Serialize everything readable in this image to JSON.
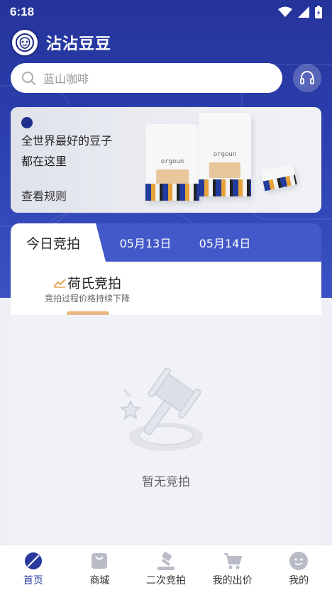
{
  "status_bar": {
    "time": "6:18"
  },
  "app": {
    "title": "沾沾豆豆"
  },
  "search": {
    "placeholder": "蓝山咖啡"
  },
  "banner": {
    "line1": "全世界最好的豆子",
    "line2": "都在这里",
    "link": "查看规则",
    "product_brand": "orgoun"
  },
  "date_tabs": [
    {
      "label": "今日竞拍",
      "active": true
    },
    {
      "label": "05月13日",
      "active": false
    },
    {
      "label": "05月14日",
      "active": false
    }
  ],
  "section": {
    "title": "荷氏竞拍",
    "subtitle": "竞拍过程价格持续下降"
  },
  "empty_state": {
    "text": "暂无竞拍"
  },
  "bottom_nav": [
    {
      "label": "首页",
      "icon": "coffee-bean-icon",
      "active": true
    },
    {
      "label": "商城",
      "icon": "shopping-bag-icon",
      "active": false
    },
    {
      "label": "二次竞拍",
      "icon": "auction-hammer-icon",
      "active": false
    },
    {
      "label": "我的出价",
      "icon": "cart-icon",
      "active": false
    },
    {
      "label": "我的",
      "icon": "profile-avatar-icon",
      "active": false
    }
  ],
  "colors": {
    "brand_blue": "#2c3fae",
    "tab_blue": "#4359c9",
    "active_nav": "#2a3a9e",
    "accent_orange": "#e9b782"
  }
}
